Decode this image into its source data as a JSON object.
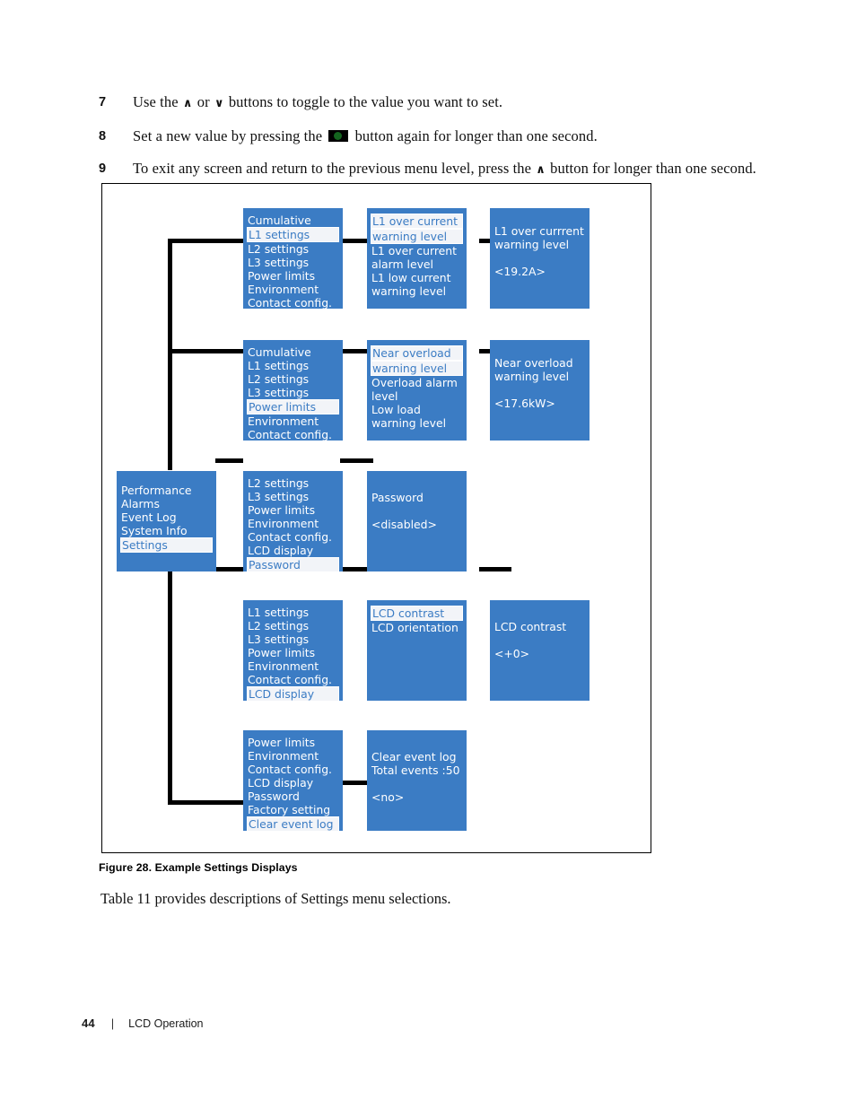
{
  "steps": [
    {
      "num": "7",
      "parts": [
        {
          "t": "text",
          "v": "Use the "
        },
        {
          "t": "up-glyph",
          "v": "∧"
        },
        {
          "t": "text",
          "v": " or "
        },
        {
          "t": "down-glyph",
          "v": "∨"
        },
        {
          "t": "text",
          "v": " buttons to toggle to the value you want to set."
        }
      ]
    },
    {
      "num": "8",
      "parts": [
        {
          "t": "text",
          "v": "Set a new value by pressing the "
        },
        {
          "t": "button-glyph",
          "v": ""
        },
        {
          "t": "text",
          "v": " button again for longer than one second."
        }
      ]
    },
    {
      "num": "9",
      "parts": [
        {
          "t": "text",
          "v": "To exit any screen and return to the previous menu level, press the "
        },
        {
          "t": "up-glyph",
          "v": "∧"
        },
        {
          "t": "text",
          "v": " button for longer than one second."
        }
      ]
    }
  ],
  "figure": {
    "caption": "Figure 28. Example Settings Displays",
    "after_text": "Table 11 provides descriptions of Settings menu selections.",
    "screen_bg_color": "#3b7cc4",
    "screen_text_color": "#ffffff",
    "selected_bg_color": "#f2f4f8",
    "selected_text_color": "#3b7cc4",
    "wire_color": "#000000",
    "screens": {
      "main_menu": {
        "name": "main-menu-screen",
        "lines": [
          {
            "text": "Performance",
            "selected": false
          },
          {
            "text": "Alarms",
            "selected": false
          },
          {
            "text": "Event Log",
            "selected": false
          },
          {
            "text": "System Info",
            "selected": false
          },
          {
            "text": "Settings",
            "selected": true
          }
        ]
      },
      "row1_level2": {
        "name": "l1-settings-menu-screen",
        "lines": [
          {
            "text": "Cumulative",
            "selected": false
          },
          {
            "text": "L1 settings",
            "selected": true
          },
          {
            "text": "L2 settings",
            "selected": false
          },
          {
            "text": "L3 settings",
            "selected": false
          },
          {
            "text": "Power limits",
            "selected": false
          },
          {
            "text": "Environment",
            "selected": false
          },
          {
            "text": "Contact config.",
            "selected": false
          }
        ]
      },
      "row1_level3": {
        "name": "l1-current-levels-screen",
        "lines": [
          {
            "text": "L1 over current",
            "selected": true
          },
          {
            "text": "warning level",
            "selected": true
          },
          {
            "text": "L1 over current",
            "selected": false
          },
          {
            "text": "alarm level",
            "selected": false
          },
          {
            "text": "L1 low current",
            "selected": false
          },
          {
            "text": "warning level",
            "selected": false
          }
        ]
      },
      "row1_level4": {
        "name": "l1-over-current-warning-value-screen",
        "lines": [
          {
            "text": "L1 over currrent",
            "selected": false
          },
          {
            "text": "warning level",
            "selected": false
          },
          {
            "text": "",
            "selected": false
          },
          {
            "text": "<19.2A>",
            "selected": false
          }
        ]
      },
      "row2_level2": {
        "name": "power-limits-menu-screen",
        "lines": [
          {
            "text": "Cumulative",
            "selected": false
          },
          {
            "text": "L1 settings",
            "selected": false
          },
          {
            "text": "L2 settings",
            "selected": false
          },
          {
            "text": "L3 settings",
            "selected": false
          },
          {
            "text": "Power limits",
            "selected": true
          },
          {
            "text": "Environment",
            "selected": false
          },
          {
            "text": "Contact config.",
            "selected": false
          }
        ]
      },
      "row2_level3": {
        "name": "overload-levels-screen",
        "lines": [
          {
            "text": "Near overload",
            "selected": true
          },
          {
            "text": "warning level",
            "selected": true
          },
          {
            "text": "Overload alarm",
            "selected": false
          },
          {
            "text": "level",
            "selected": false
          },
          {
            "text": "Low load",
            "selected": false
          },
          {
            "text": "warning level",
            "selected": false
          }
        ]
      },
      "row2_level4": {
        "name": "near-overload-warning-value-screen",
        "lines": [
          {
            "text": "Near overload",
            "selected": false
          },
          {
            "text": "warning level",
            "selected": false
          },
          {
            "text": "",
            "selected": false
          },
          {
            "text": "<17.6kW>",
            "selected": false
          }
        ]
      },
      "row3_level2": {
        "name": "password-menu-screen",
        "lines": [
          {
            "text": "L2 settings",
            "selected": false
          },
          {
            "text": "L3 settings",
            "selected": false
          },
          {
            "text": "Power limits",
            "selected": false
          },
          {
            "text": "Environment",
            "selected": false
          },
          {
            "text": "Contact config.",
            "selected": false
          },
          {
            "text": "LCD display",
            "selected": false
          },
          {
            "text": "Password",
            "selected": true
          }
        ]
      },
      "row3_level3": {
        "name": "password-value-screen",
        "lines": [
          {
            "text": "Password",
            "selected": false
          },
          {
            "text": "",
            "selected": false
          },
          {
            "text": "<disabled>",
            "selected": false
          }
        ]
      },
      "row4_level2": {
        "name": "lcd-display-menu-screen",
        "lines": [
          {
            "text": "L1 settings",
            "selected": false
          },
          {
            "text": "L2 settings",
            "selected": false
          },
          {
            "text": "L3 settings",
            "selected": false
          },
          {
            "text": "Power limits",
            "selected": false
          },
          {
            "text": "Environment",
            "selected": false
          },
          {
            "text": "Contact config.",
            "selected": false
          },
          {
            "text": "LCD display",
            "selected": true
          }
        ]
      },
      "row4_level3": {
        "name": "lcd-contrast-menu-screen",
        "lines": [
          {
            "text": "LCD contrast",
            "selected": true
          },
          {
            "text": "LCD orientation",
            "selected": false
          }
        ]
      },
      "row4_level4": {
        "name": "lcd-contrast-value-screen",
        "lines": [
          {
            "text": "LCD contrast",
            "selected": false
          },
          {
            "text": "",
            "selected": false
          },
          {
            "text": "<+0>",
            "selected": false
          }
        ]
      },
      "row5_level2": {
        "name": "clear-event-log-menu-screen",
        "lines": [
          {
            "text": "Power limits",
            "selected": false
          },
          {
            "text": "Environment",
            "selected": false
          },
          {
            "text": "Contact config.",
            "selected": false
          },
          {
            "text": "LCD display",
            "selected": false
          },
          {
            "text": "Password",
            "selected": false
          },
          {
            "text": "Factory setting",
            "selected": false
          },
          {
            "text": "Clear event log",
            "selected": true
          }
        ]
      },
      "row5_level3": {
        "name": "clear-event-log-value-screen",
        "lines": [
          {
            "text": "Clear event log",
            "selected": false
          },
          {
            "text": "Total events :50",
            "selected": false
          },
          {
            "text": "",
            "selected": false
          },
          {
            "text": "<no>",
            "selected": false
          }
        ]
      }
    }
  },
  "footer": {
    "page_number": "44",
    "separator": "|",
    "section": "LCD Operation"
  }
}
